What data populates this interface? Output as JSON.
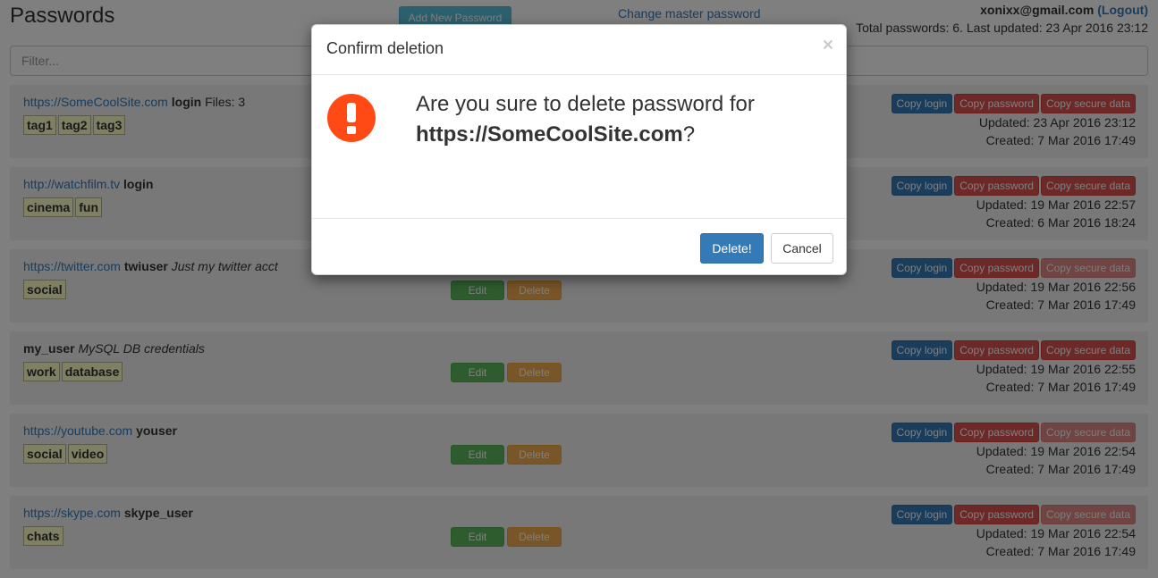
{
  "header": {
    "title": "Passwords",
    "add_button": "Add New Password",
    "master_link": "Change master password",
    "user_email": "xonixx@gmail.com",
    "logout": "(Logout)",
    "totals": "Total passwords: 6. Last updated: 23 Apr 2016 23:12"
  },
  "filter": {
    "placeholder": "Filter..."
  },
  "buttons": {
    "copy_login": "Copy login",
    "copy_password": "Copy password",
    "copy_secure": "Copy secure data",
    "edit": "Edit",
    "delete": "Delete"
  },
  "entries": [
    {
      "url": "https://SomeCoolSite.com",
      "login": "login",
      "note": "",
      "files": "Files: 3",
      "tags": [
        "tag1",
        "tag2",
        "tag3"
      ],
      "updated": "Updated: 23 Apr 2016 23:12",
      "created": "Created: 7 Mar 2016 17:49",
      "secure_enabled": true
    },
    {
      "url": "http://watchfilm.tv",
      "login": "login",
      "note": "",
      "files": "",
      "tags": [
        "cinema",
        "fun"
      ],
      "updated": "Updated: 19 Mar 2016 22:57",
      "created": "Created: 6 Mar 2016 18:24",
      "secure_enabled": true
    },
    {
      "url": "https://twitter.com",
      "login": "twiuser",
      "note": "Just my twitter acct",
      "files": "",
      "tags": [
        "social"
      ],
      "updated": "Updated: 19 Mar 2016 22:56",
      "created": "Created: 7 Mar 2016 17:49",
      "secure_enabled": false
    },
    {
      "url": "",
      "login": "my_user",
      "note": "MySQL DB credentials",
      "files": "",
      "tags": [
        "work",
        "database"
      ],
      "updated": "Updated: 19 Mar 2016 22:55",
      "created": "Created: 7 Mar 2016 17:49",
      "secure_enabled": true
    },
    {
      "url": "https://youtube.com",
      "login": "youser",
      "note": "",
      "files": "",
      "tags": [
        "social",
        "video"
      ],
      "updated": "Updated: 19 Mar 2016 22:54",
      "created": "Created: 7 Mar 2016 17:49",
      "secure_enabled": false
    },
    {
      "url": "https://skype.com",
      "login": "skype_user",
      "note": "",
      "files": "",
      "tags": [
        "chats"
      ],
      "updated": "Updated: 19 Mar 2016 22:54",
      "created": "Created: 7 Mar 2016 17:49",
      "secure_enabled": false
    }
  ],
  "modal": {
    "title": "Confirm deletion",
    "close": "×",
    "message_prefix": "Are you sure to delete password for",
    "target": "https://SomeCoolSite.com",
    "message_suffix": "?",
    "confirm": "Delete!",
    "cancel": "Cancel",
    "icon": "exclamation-circle-icon",
    "icon_color": "#ff4a16"
  },
  "colors": {
    "primary": "#337ab7",
    "danger": "#d9534f",
    "success": "#5cb85c",
    "warning": "#f0ad4e",
    "info": "#5bc0de",
    "tag_bg": "#ffffc8"
  }
}
